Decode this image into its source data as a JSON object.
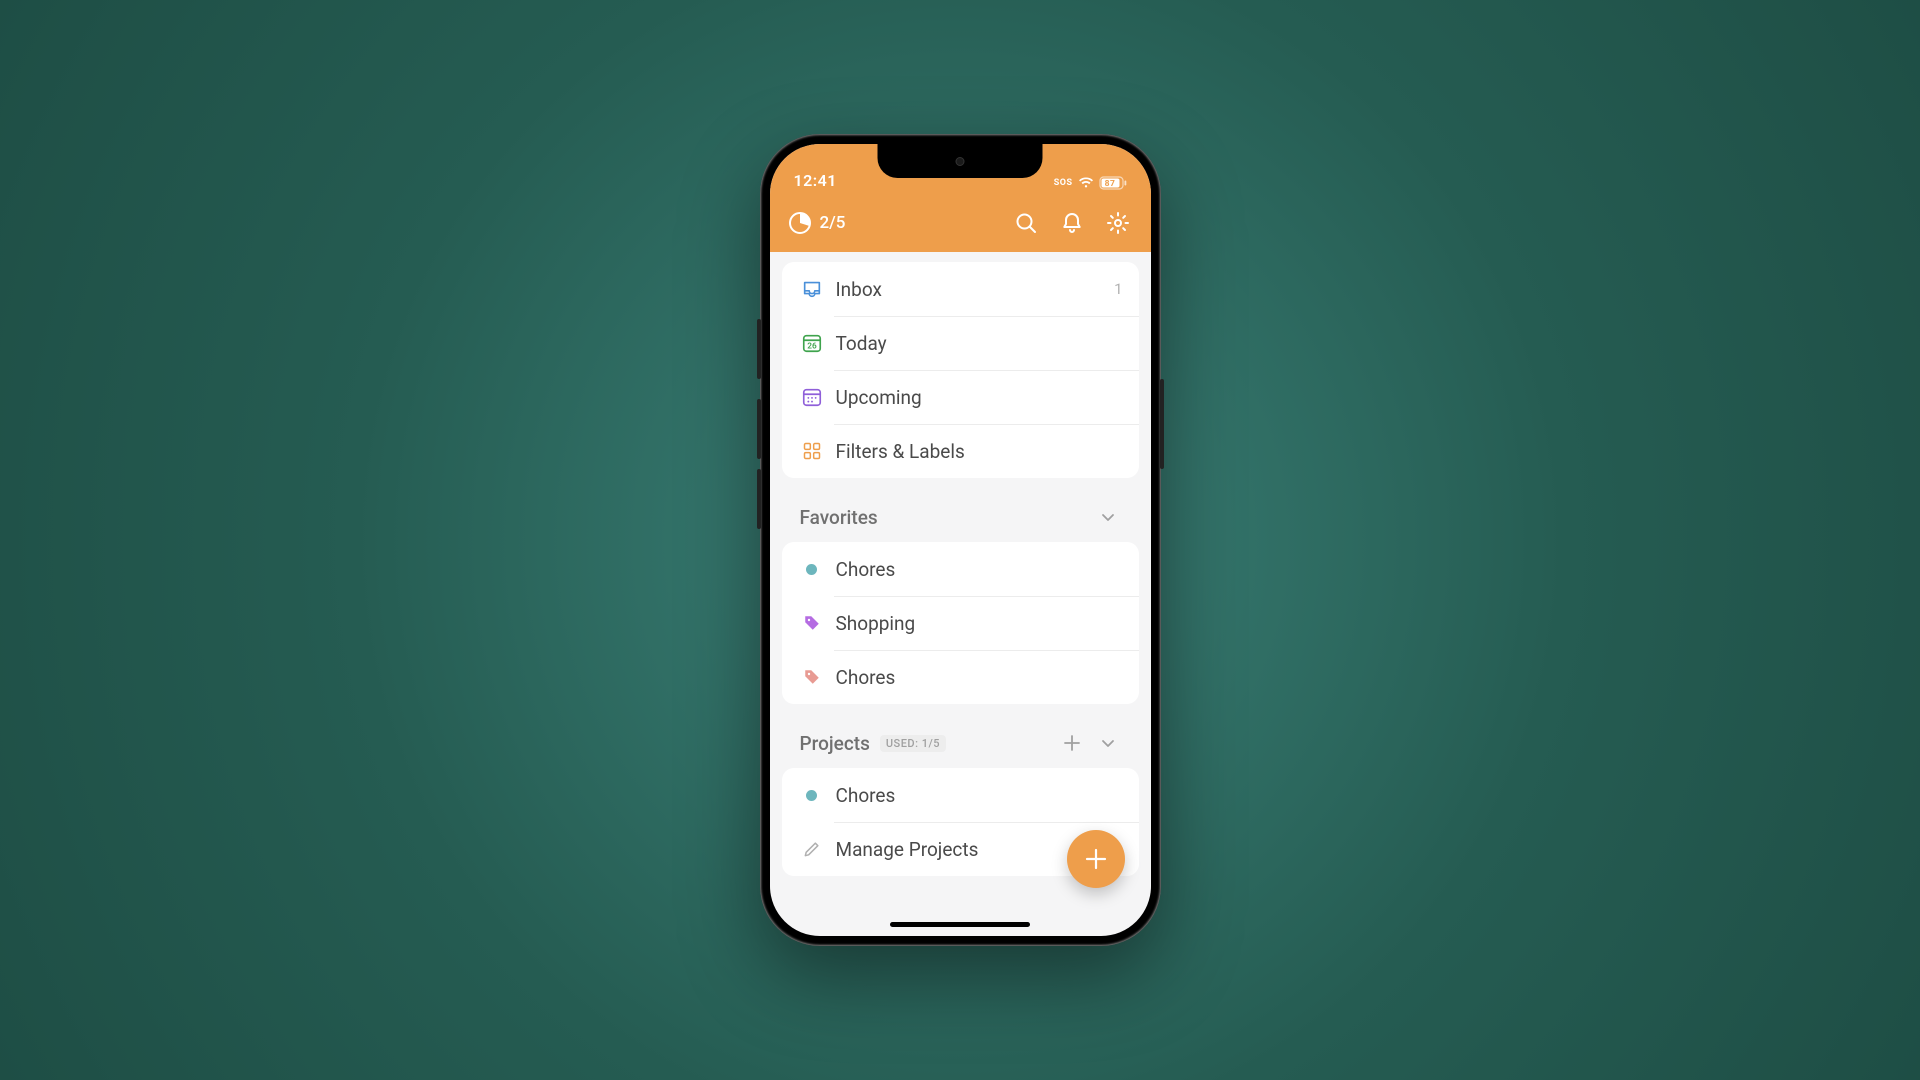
{
  "status": {
    "time": "12:41",
    "sos": "SOS",
    "battery": "87"
  },
  "appbar": {
    "progress": "2/5"
  },
  "nav": {
    "inbox": {
      "label": "Inbox",
      "count": "1"
    },
    "today": {
      "label": "Today"
    },
    "upcoming": {
      "label": "Upcoming"
    },
    "filters": {
      "label": "Filters & Labels"
    }
  },
  "favorites": {
    "title": "Favorites",
    "items": [
      {
        "label": "Chores",
        "color": "#6db6bd",
        "type": "project"
      },
      {
        "label": "Shopping",
        "color": "#b56ce2",
        "type": "label"
      },
      {
        "label": "Chores",
        "color": "#e89b93",
        "type": "label"
      }
    ]
  },
  "projects": {
    "title": "Projects",
    "usage": "USED: 1/5",
    "items": [
      {
        "label": "Chores",
        "color": "#6db6bd"
      }
    ],
    "manage": "Manage Projects"
  }
}
